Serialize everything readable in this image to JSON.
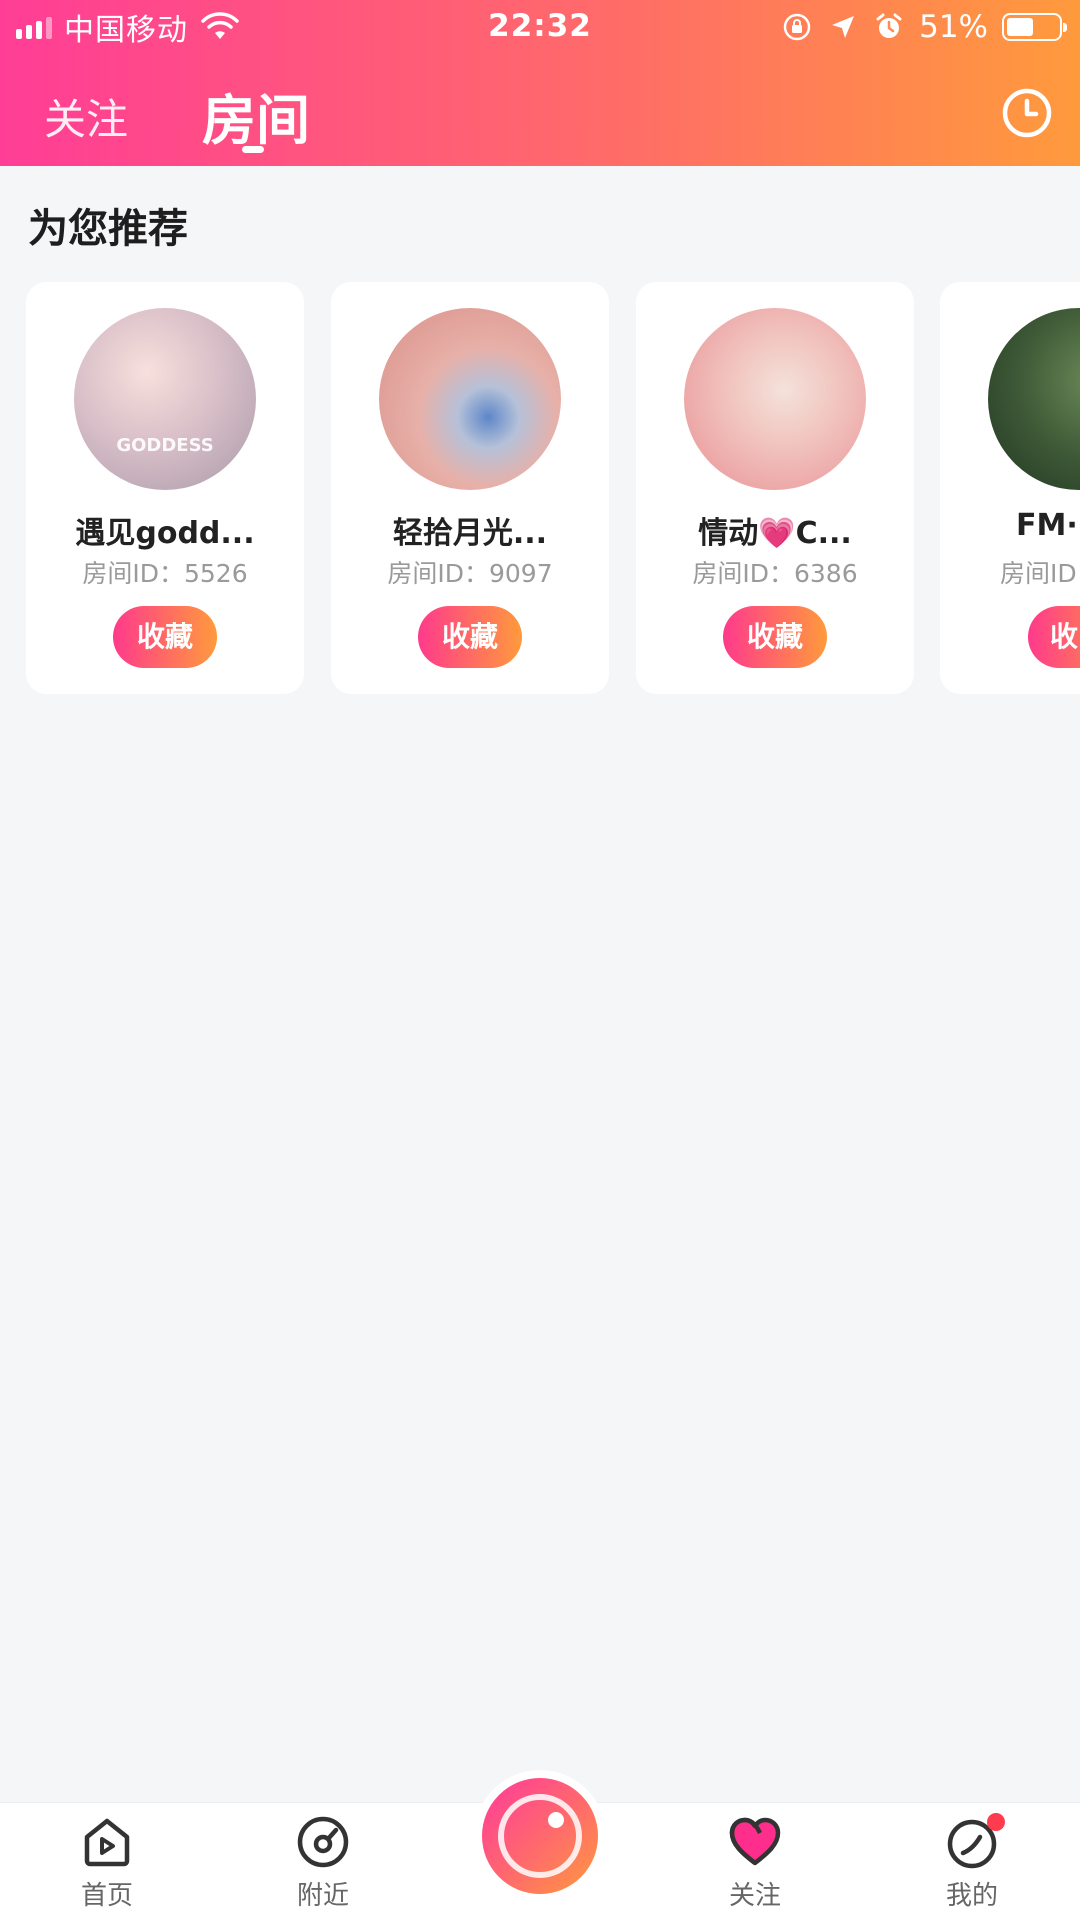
{
  "status_bar": {
    "carrier": "中国移动",
    "time": "22:32",
    "battery_percent": "51%",
    "battery_level": 0.51,
    "icons": [
      "signal-icon",
      "wifi-icon",
      "orientation-lock-icon",
      "location-arrow-icon",
      "alarm-icon",
      "battery-icon"
    ]
  },
  "header": {
    "tabs": [
      {
        "label": "关注",
        "active": false
      },
      {
        "label": "房间",
        "active": true
      }
    ],
    "right_icon": "clock-icon"
  },
  "section": {
    "title": "为您推荐"
  },
  "rooms": [
    {
      "name": "遇见godd...",
      "room_id": "房间ID：5526",
      "button": "收藏"
    },
    {
      "name": "轻拾月光...",
      "room_id": "房间ID：9097",
      "button": "收藏"
    },
    {
      "name": "情动💗C...",
      "room_id": "房间ID：6386",
      "button": "收藏"
    },
    {
      "name": "FM·",
      "room_id": "房间ID",
      "button": "收"
    }
  ],
  "bottom_nav": {
    "items": [
      {
        "label": "首页",
        "icon": "home-play-icon"
      },
      {
        "label": "附近",
        "icon": "nearby-compass-icon"
      },
      {
        "label": "关注",
        "icon": "heart-icon",
        "active": true
      },
      {
        "label": "我的",
        "icon": "profile-icon",
        "has_badge": true
      }
    ],
    "center_icon": "live-record-icon"
  },
  "colors": {
    "gradient_start": "#ff3d96",
    "gradient_end": "#ff9a3c",
    "background": "#f5f6f8",
    "badge": "#ff3b4e"
  }
}
